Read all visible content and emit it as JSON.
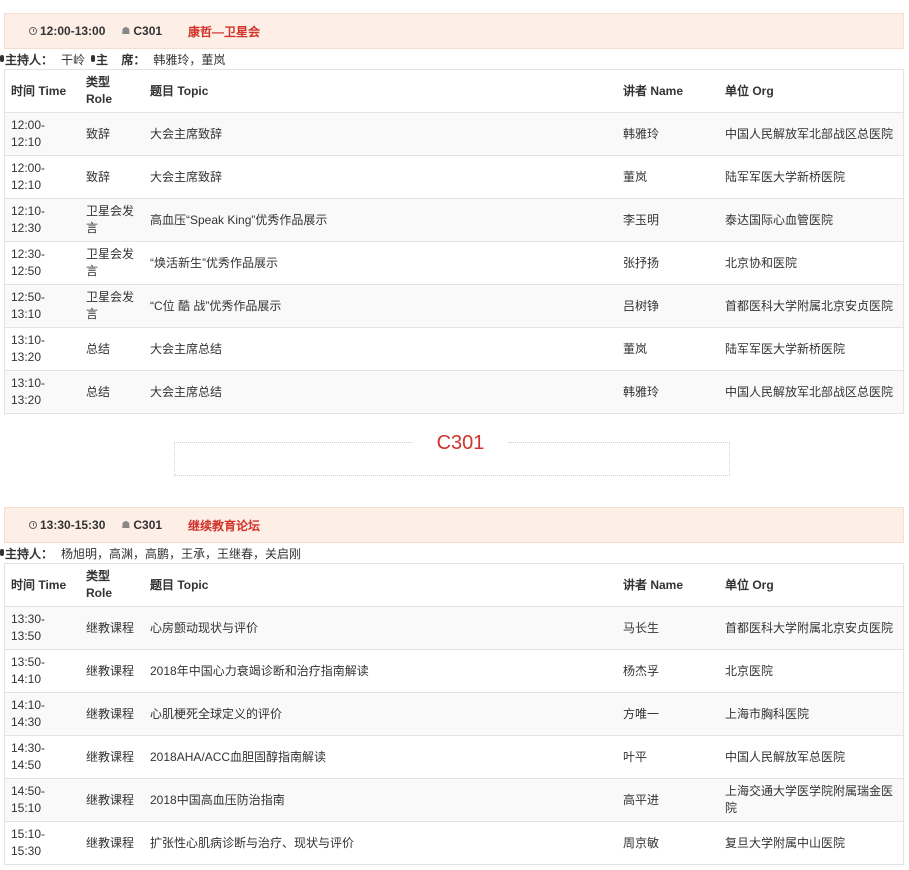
{
  "columns": {
    "time": "时间 Time",
    "role": "类型 Role",
    "topic": "题目 Topic",
    "speaker": "讲者 Name",
    "org": "单位 Org"
  },
  "session1": {
    "time": "12:00-13:00",
    "room": "C301",
    "title": "康哲—卫星会",
    "host_label": "主持人：",
    "host_names": "干岭",
    "chair_label": "主    席：",
    "chair_names": "韩雅玲，董岚",
    "rows": [
      {
        "time": "12:00-12:10",
        "role": "致辞",
        "topic": "大会主席致辞",
        "speaker": "韩雅玲",
        "org": "中国人民解放军北部战区总医院"
      },
      {
        "time": "12:00-12:10",
        "role": "致辞",
        "topic": "大会主席致辞",
        "speaker": "董岚",
        "org": "陆军军医大学新桥医院"
      },
      {
        "time": "12:10-12:30",
        "role": "卫星会发言",
        "topic": "高血压“Speak King”优秀作品展示",
        "speaker": "李玉明",
        "org": "泰达国际心血管医院"
      },
      {
        "time": "12:30-12:50",
        "role": "卫星会发言",
        "topic": "“焕活新生”优秀作品展示",
        "speaker": "张抒扬",
        "org": "北京协和医院"
      },
      {
        "time": "12:50-13:10",
        "role": "卫星会发言",
        "topic": "“C位 酷 战”优秀作品展示",
        "speaker": "吕树铮",
        "org": "首都医科大学附属北京安贞医院"
      },
      {
        "time": "13:10-13:20",
        "role": "总结",
        "topic": "大会主席总结",
        "speaker": "董岚",
        "org": "陆军军医大学新桥医院"
      },
      {
        "time": "13:10-13:20",
        "role": "总结",
        "topic": "大会主席总结",
        "speaker": "韩雅玲",
        "org": "中国人民解放军北部战区总医院"
      }
    ]
  },
  "divider_label": "C301",
  "session2": {
    "time": "13:30-15:30",
    "room": "C301",
    "title": "继续教育论坛",
    "host_label": "主持人：",
    "host_names": "杨旭明，高渊，高鹏，王承，王继春，关启刚",
    "rows": [
      {
        "time": "13:30-13:50",
        "role": "继教课程",
        "topic": "心房颤动现状与评价",
        "speaker": "马长生",
        "org": "首都医科大学附属北京安贞医院"
      },
      {
        "time": "13:50-14:10",
        "role": "继教课程",
        "topic": "2018年中国心力衰竭诊断和治疗指南解读",
        "speaker": "杨杰孚",
        "org": "北京医院"
      },
      {
        "time": "14:10-14:30",
        "role": "继教课程",
        "topic": "心肌梗死全球定义的评价",
        "speaker": "方唯一",
        "org": "上海市胸科医院"
      },
      {
        "time": "14:30-14:50",
        "role": "继教课程",
        "topic": "2018AHA/ACC血胆固醇指南解读",
        "speaker": "叶平",
        "org": "中国人民解放军总医院"
      },
      {
        "time": "14:50-15:10",
        "role": "继教课程",
        "topic": "2018中国高血压防治指南",
        "speaker": "高平进",
        "org": "上海交通大学医学院附属瑞金医院"
      },
      {
        "time": "15:10-15:30",
        "role": "继教课程",
        "topic": "扩张性心肌病诊断与治疗、现状与评价",
        "speaker": "周京敏",
        "org": "复旦大学附属中山医院"
      }
    ]
  }
}
